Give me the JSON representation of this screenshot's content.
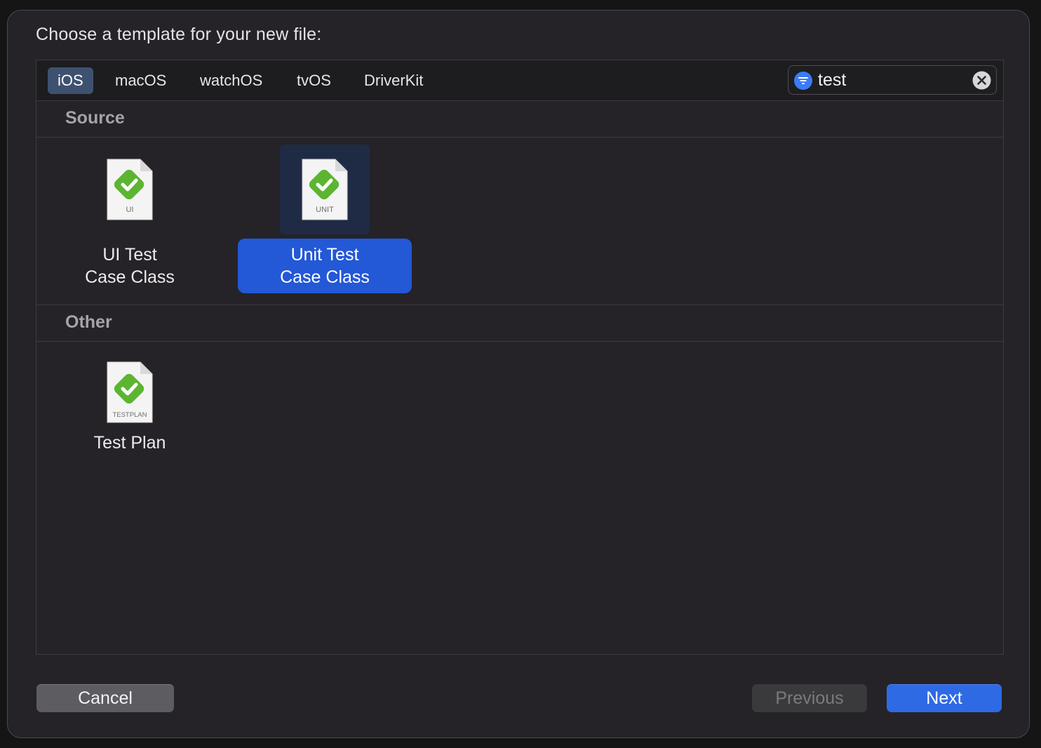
{
  "dialog": {
    "prompt": "Choose a template for your new file:"
  },
  "tabs": [
    {
      "label": "iOS",
      "selected": true
    },
    {
      "label": "macOS",
      "selected": false
    },
    {
      "label": "watchOS",
      "selected": false
    },
    {
      "label": "tvOS",
      "selected": false
    },
    {
      "label": "DriverKit",
      "selected": false
    }
  ],
  "search": {
    "value": "test",
    "icon": "filter-icon",
    "clear_icon": "clear-icon"
  },
  "sections": [
    {
      "title": "Source",
      "templates": [
        {
          "label": "UI Test\nCase Class",
          "badge": "UI",
          "icon": "ui-test-file-icon",
          "selected": false
        },
        {
          "label": "Unit Test\nCase Class",
          "badge": "UNIT",
          "icon": "unit-test-file-icon",
          "selected": true
        }
      ]
    },
    {
      "title": "Other",
      "templates": [
        {
          "label": "Test Plan",
          "badge": "TESTPLAN",
          "icon": "test-plan-file-icon",
          "selected": false
        }
      ]
    }
  ],
  "buttons": {
    "cancel": "Cancel",
    "previous": "Previous",
    "next": "Next"
  },
  "colors": {
    "accent": "#2358d6",
    "checkmark": "#5cb531",
    "tab_selected": "#3e5170"
  }
}
